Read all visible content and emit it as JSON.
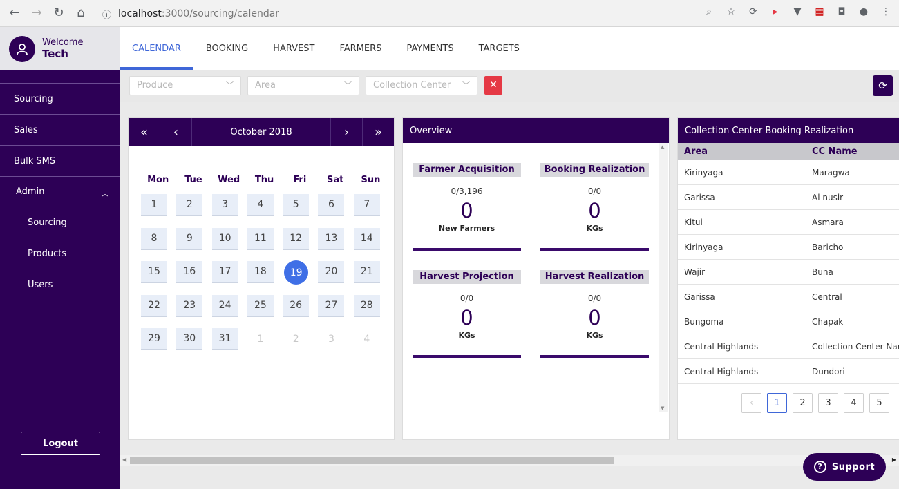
{
  "browser": {
    "url_host": "localhost",
    "url_path": ":3000/sourcing/calendar"
  },
  "sidebar": {
    "welcome": "Welcome",
    "user": "Tech",
    "items": [
      {
        "label": "Sourcing"
      },
      {
        "label": "Sales"
      },
      {
        "label": "Bulk SMS"
      },
      {
        "label": "Admin"
      }
    ],
    "subitems": [
      {
        "label": "Sourcing"
      },
      {
        "label": "Products"
      },
      {
        "label": "Users"
      }
    ],
    "logout": "Logout"
  },
  "tabs": [
    {
      "label": "CALENDAR",
      "active": true
    },
    {
      "label": "BOOKING"
    },
    {
      "label": "HARVEST"
    },
    {
      "label": "FARMERS"
    },
    {
      "label": "PAYMENTS"
    },
    {
      "label": "TARGETS"
    }
  ],
  "filters": {
    "produce": "Produce",
    "area": "Area",
    "collection_center": "Collection Center"
  },
  "calendar": {
    "title": "October 2018",
    "nav": {
      "prev_year": "«",
      "prev": "‹",
      "next": "›",
      "next_year": "»"
    },
    "weekdays": [
      "Mon",
      "Tue",
      "Wed",
      "Thu",
      "Fri",
      "Sat",
      "Sun"
    ],
    "days": [
      "1",
      "2",
      "3",
      "4",
      "5",
      "6",
      "7",
      "8",
      "9",
      "10",
      "11",
      "12",
      "13",
      "14",
      "15",
      "16",
      "17",
      "18",
      "19",
      "20",
      "21",
      "22",
      "23",
      "24",
      "25",
      "26",
      "27",
      "28",
      "29",
      "30",
      "31"
    ],
    "next_month_days": [
      "1",
      "2",
      "3",
      "4"
    ],
    "selected": "19"
  },
  "overview": {
    "title": "Overview",
    "cards": [
      {
        "title": "Farmer Acquisition",
        "ratio": "0/3,196",
        "value": "0",
        "unit": "New Farmers"
      },
      {
        "title": "Booking Realization",
        "ratio": "0/0",
        "value": "0",
        "unit": "KGs"
      },
      {
        "title": "Harvest Projection",
        "ratio": "0/0",
        "value": "0",
        "unit": "KGs"
      },
      {
        "title": "Harvest Realization",
        "ratio": "0/0",
        "value": "0",
        "unit": "KGs"
      }
    ]
  },
  "realization": {
    "title": "Collection Center Booking Realization",
    "columns": [
      "Area",
      "CC Name"
    ],
    "rows": [
      [
        "Kirinyaga",
        "Maragwa"
      ],
      [
        "Garissa",
        "Al nusir"
      ],
      [
        "Kitui",
        "Asmara"
      ],
      [
        "Kirinyaga",
        "Baricho"
      ],
      [
        "Wajir",
        "Buna"
      ],
      [
        "Garissa",
        "Central"
      ],
      [
        "Bungoma",
        "Chapak"
      ],
      [
        "Central Highlands",
        "Collection Center Name"
      ],
      [
        "Central Highlands",
        "Dundori"
      ]
    ],
    "pages": [
      "1",
      "2",
      "3",
      "4",
      "5"
    ],
    "current_page": "1",
    "prev_label": "‹"
  },
  "support": "Support",
  "colors": {
    "brand": "#2d0056",
    "accent": "#3f67d8",
    "danger": "#e53945"
  }
}
